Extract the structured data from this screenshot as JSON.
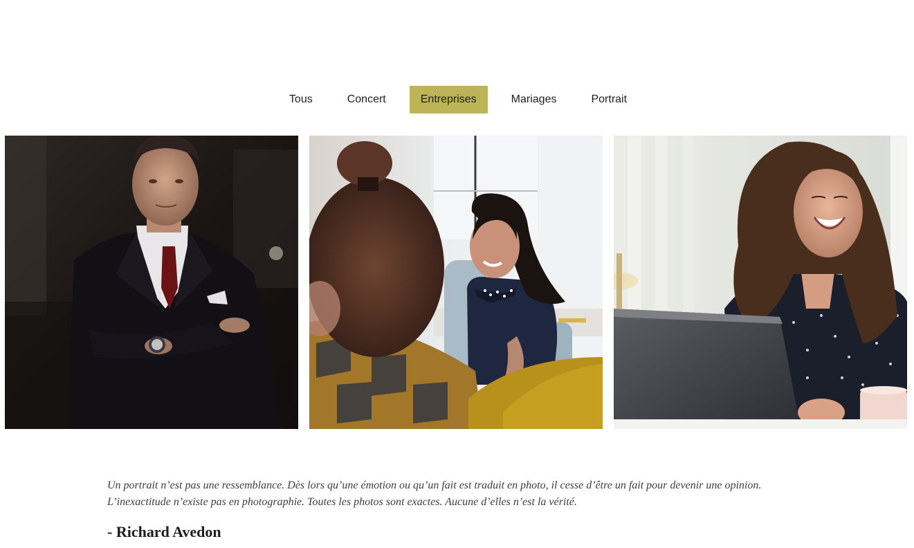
{
  "filters": [
    {
      "label": "Tous",
      "active": false
    },
    {
      "label": "Concert",
      "active": false
    },
    {
      "label": "Entreprises",
      "active": true
    },
    {
      "label": "Mariages",
      "active": false
    },
    {
      "label": "Portrait",
      "active": false
    }
  ],
  "colors": {
    "accent": "#bcb457"
  },
  "quote": {
    "line1": "Un portrait n’est pas une ressemblance. Dès lors qu’une émotion ou qu’un fait est traduit en photo, il cesse d’être un fait pour devenir une opinion.",
    "line2": "L’inexactitude n’existe pas en photographie. Toutes les photos sont exactes. Aucune d’elles n’est la vérité.",
    "author": "- Richard Avedon"
  }
}
